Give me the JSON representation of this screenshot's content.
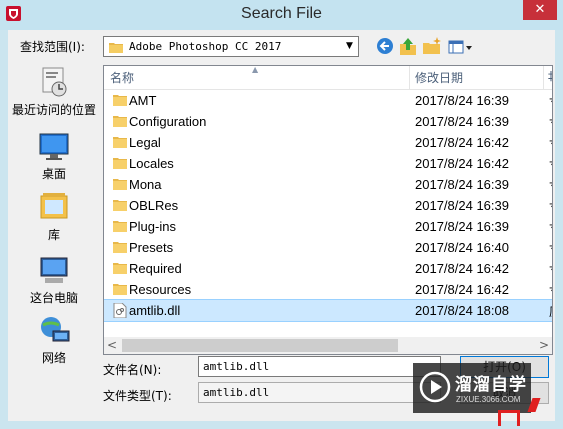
{
  "window": {
    "title": "Search File",
    "close_glyph": "✕"
  },
  "lookin": {
    "label": "查找范围(I):",
    "value": "Adobe Photoshop CC 2017"
  },
  "toolbar": {
    "back_icon": "back-arrow-icon",
    "up_icon": "up-folder-icon",
    "new_folder_icon": "new-folder-icon",
    "views_icon": "views-menu-icon"
  },
  "places": [
    {
      "label": "最近访问的位置",
      "icon": "recent-places-icon"
    },
    {
      "label": "桌面",
      "icon": "desktop-icon"
    },
    {
      "label": "库",
      "icon": "libraries-icon"
    },
    {
      "label": "这台电脑",
      "icon": "this-pc-icon"
    },
    {
      "label": "网络",
      "icon": "network-icon"
    }
  ],
  "columns": {
    "name": "名称",
    "date": "修改日期",
    "extra": "‡"
  },
  "files": [
    {
      "name": "AMT",
      "date": "2017/8/24 16:39",
      "extra": "寸",
      "type": "folder"
    },
    {
      "name": "Configuration",
      "date": "2017/8/24 16:39",
      "extra": "寸",
      "type": "folder"
    },
    {
      "name": "Legal",
      "date": "2017/8/24 16:42",
      "extra": "寸",
      "type": "folder"
    },
    {
      "name": "Locales",
      "date": "2017/8/24 16:42",
      "extra": "寸",
      "type": "folder"
    },
    {
      "name": "Mona",
      "date": "2017/8/24 16:39",
      "extra": "寸",
      "type": "folder"
    },
    {
      "name": "OBLRes",
      "date": "2017/8/24 16:39",
      "extra": "寸",
      "type": "folder"
    },
    {
      "name": "Plug-ins",
      "date": "2017/8/24 16:39",
      "extra": "寸",
      "type": "folder"
    },
    {
      "name": "Presets",
      "date": "2017/8/24 16:40",
      "extra": "寸",
      "type": "folder"
    },
    {
      "name": "Required",
      "date": "2017/8/24 16:42",
      "extra": "寸",
      "type": "folder"
    },
    {
      "name": "Resources",
      "date": "2017/8/24 16:42",
      "extra": "寸",
      "type": "folder"
    },
    {
      "name": "amtlib.dll",
      "date": "2017/8/24 18:08",
      "extra": "原",
      "type": "dll",
      "selected": true
    }
  ],
  "scroll": {
    "left": "<",
    "right": ">"
  },
  "filename": {
    "label": "文件名(N):",
    "value": "amtlib.dll"
  },
  "filetype": {
    "label": "文件类型(T):",
    "value": "amtlib.dll"
  },
  "buttons": {
    "open": "打开(O)",
    "cancel": "取消"
  },
  "watermark": {
    "text": "溜溜自学",
    "sub": "ZIXUE.3066.COM"
  },
  "colors": {
    "title_bg": "#c4e3f0",
    "close_bg": "#c7303a",
    "selection": "#cce8ff"
  }
}
